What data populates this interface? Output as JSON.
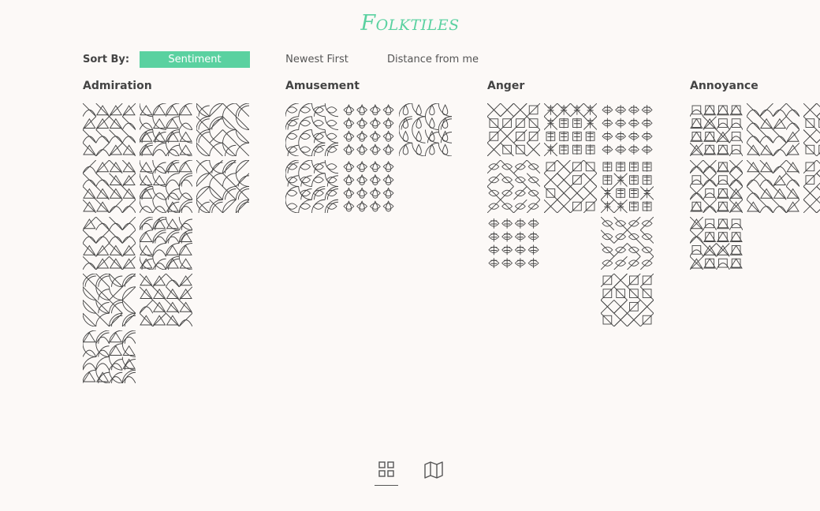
{
  "app": {
    "title": "Folktiles"
  },
  "sort": {
    "label": "Sort By:",
    "options": [
      "Sentiment",
      "Newest First",
      "Distance from me"
    ],
    "active": "Sentiment"
  },
  "categories": [
    {
      "name": "Admiration",
      "tile_count": 11
    },
    {
      "name": "Amusement",
      "tile_count": 5
    },
    {
      "name": "Anger",
      "tile_count": 9
    },
    {
      "name": "Annoyance",
      "tile_count": 7
    }
  ],
  "nav": {
    "icons": [
      "grid-view-icon",
      "map-view-icon"
    ],
    "active": "grid-view-icon"
  },
  "colors": {
    "accent": "#5ad1a0",
    "background": "#fcf9f7",
    "line": "#444444"
  }
}
